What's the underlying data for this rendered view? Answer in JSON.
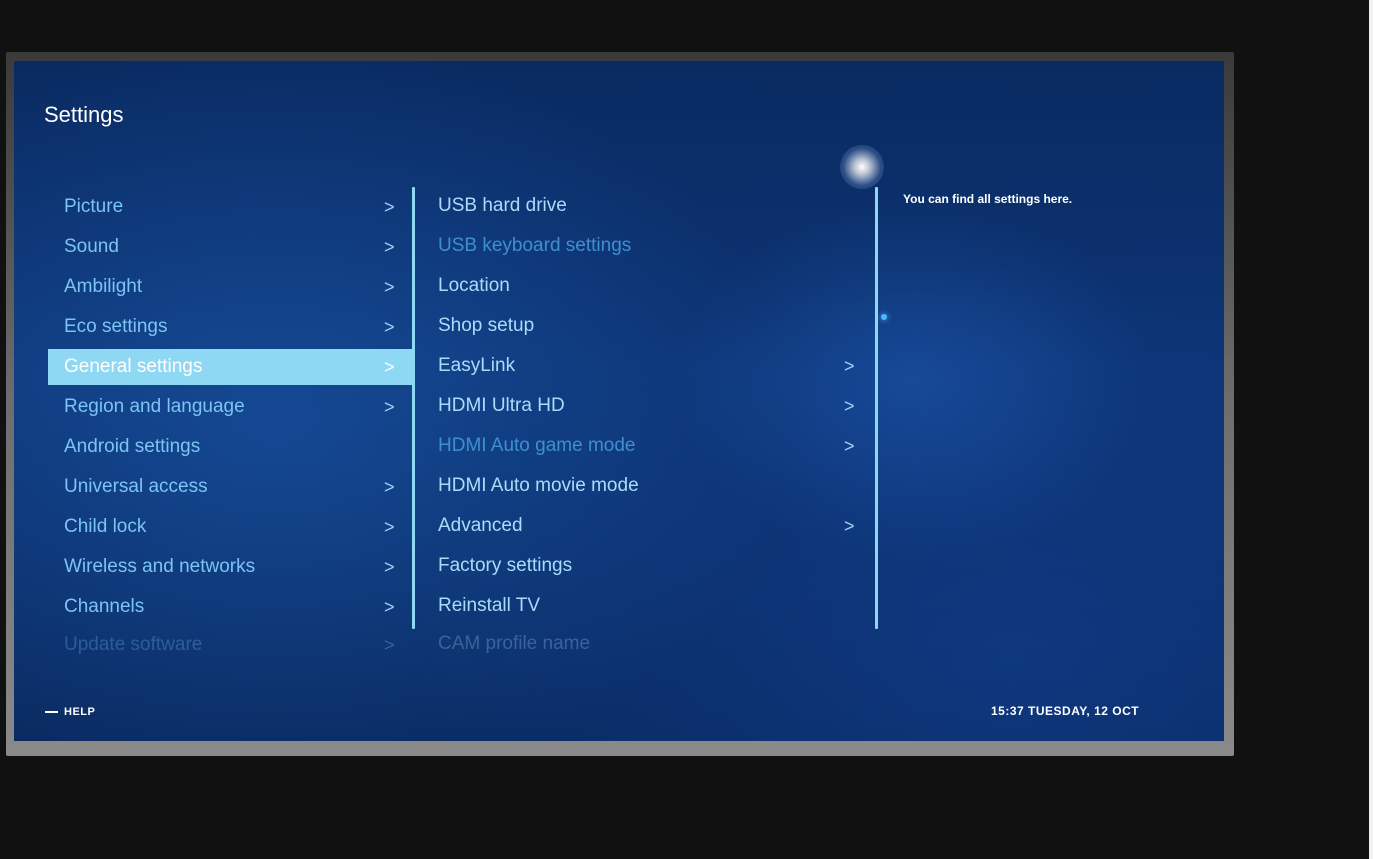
{
  "header": {
    "title": "Settings"
  },
  "main_menu": {
    "items": [
      {
        "label": "Picture",
        "chevron": ">"
      },
      {
        "label": "Sound",
        "chevron": ">"
      },
      {
        "label": "Ambilight",
        "chevron": ">"
      },
      {
        "label": "Eco settings",
        "chevron": ">"
      },
      {
        "label": "General settings",
        "chevron": ">"
      },
      {
        "label": "Region and language",
        "chevron": ">"
      },
      {
        "label": "Android settings"
      },
      {
        "label": "Universal access",
        "chevron": ">"
      },
      {
        "label": "Child lock",
        "chevron": ">"
      },
      {
        "label": "Wireless and networks",
        "chevron": ">"
      },
      {
        "label": "Channels",
        "chevron": ">"
      },
      {
        "label": "Update software",
        "chevron": ">"
      }
    ],
    "selected": "General settings"
  },
  "submenu": {
    "items": [
      {
        "label": "USB hard drive"
      },
      {
        "label": "USB keyboard settings"
      },
      {
        "label": "Location"
      },
      {
        "label": "Shop setup"
      },
      {
        "label": "EasyLink",
        "chevron": ">"
      },
      {
        "label": "HDMI Ultra HD",
        "chevron": ">"
      },
      {
        "label": "HDMI Auto game mode",
        "chevron": ">"
      },
      {
        "label": "HDMI Auto movie mode"
      },
      {
        "label": "Advanced",
        "chevron": ">"
      },
      {
        "label": "Factory settings"
      },
      {
        "label": "Reinstall TV"
      },
      {
        "label": "CAM profile name"
      }
    ]
  },
  "description": "You can find all settings here.",
  "footer": {
    "help_label": "HELP",
    "clock": "15:37 TUESDAY, 12 OCT"
  },
  "colors": {
    "background": "#0d3474",
    "highlight": "#8fd8f4",
    "text": "#7cc4f4",
    "dim_text": "#3f8fd0"
  }
}
